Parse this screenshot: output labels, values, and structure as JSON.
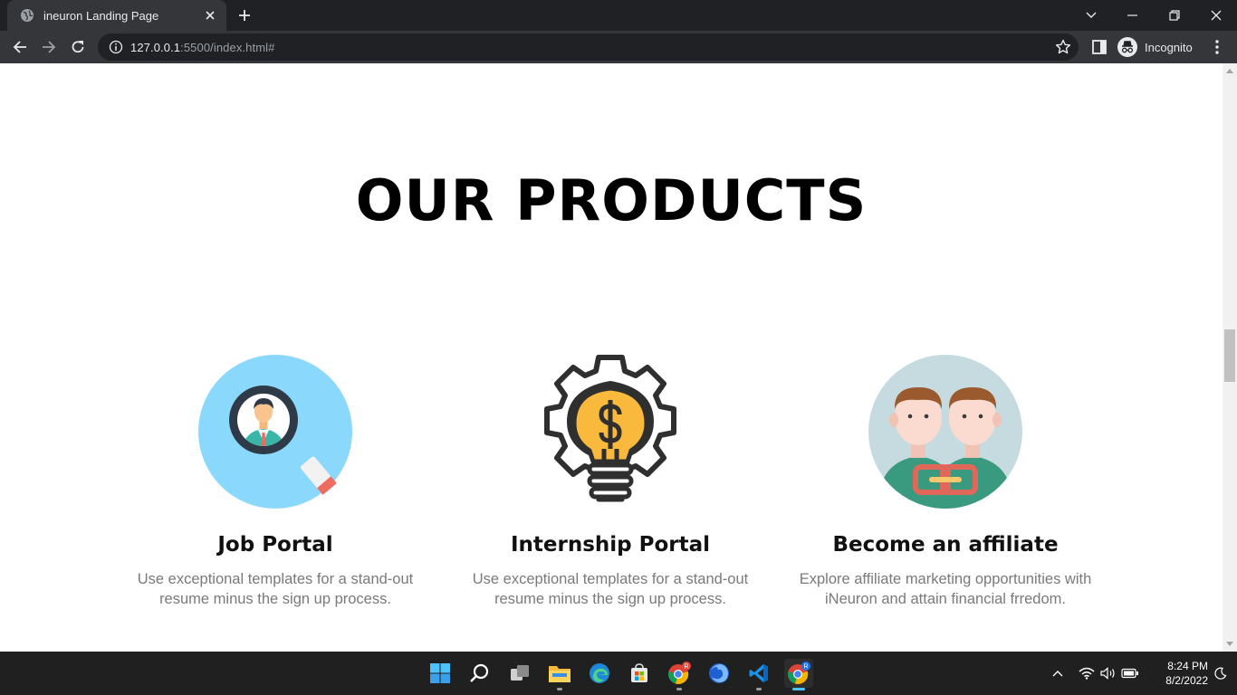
{
  "browser": {
    "tab_title": "ineuron Landing Page",
    "url_host": "127.0.0.1",
    "url_rest": ":5500/index.html#",
    "profile_label": "Incognito"
  },
  "page": {
    "heading": "OUR PRODUCTS",
    "products": [
      {
        "name": "Job Portal",
        "desc_line1": "Use exceptional templates for a stand-out",
        "desc_line2": "resume minus the sign up process.",
        "icon": "job-search-icon"
      },
      {
        "name": "Internship Portal",
        "desc_line1": "Use exceptional templates for a stand-out",
        "desc_line2": "resume minus the sign up process.",
        "icon": "lightbulb-gear-icon"
      },
      {
        "name": "Become an affiliate",
        "desc_line1": "Explore affiliate marketing opportunities with",
        "desc_line2": "iNeuron and attain financial frredom.",
        "icon": "affiliate-people-icon"
      }
    ]
  },
  "taskbar": {
    "time": "8:24 PM",
    "date": "8/2/2022",
    "badge_chrome1": "R",
    "badge_chrome2": "R"
  },
  "colors": {
    "chrome_dark": "#202124",
    "chrome_toolbar": "#35363a",
    "job_portal_circle": "#8ad8fc",
    "affiliate_circle": "#c5dbdf",
    "bulb_yellow": "#f9b93c",
    "taskbar": "#202020"
  }
}
